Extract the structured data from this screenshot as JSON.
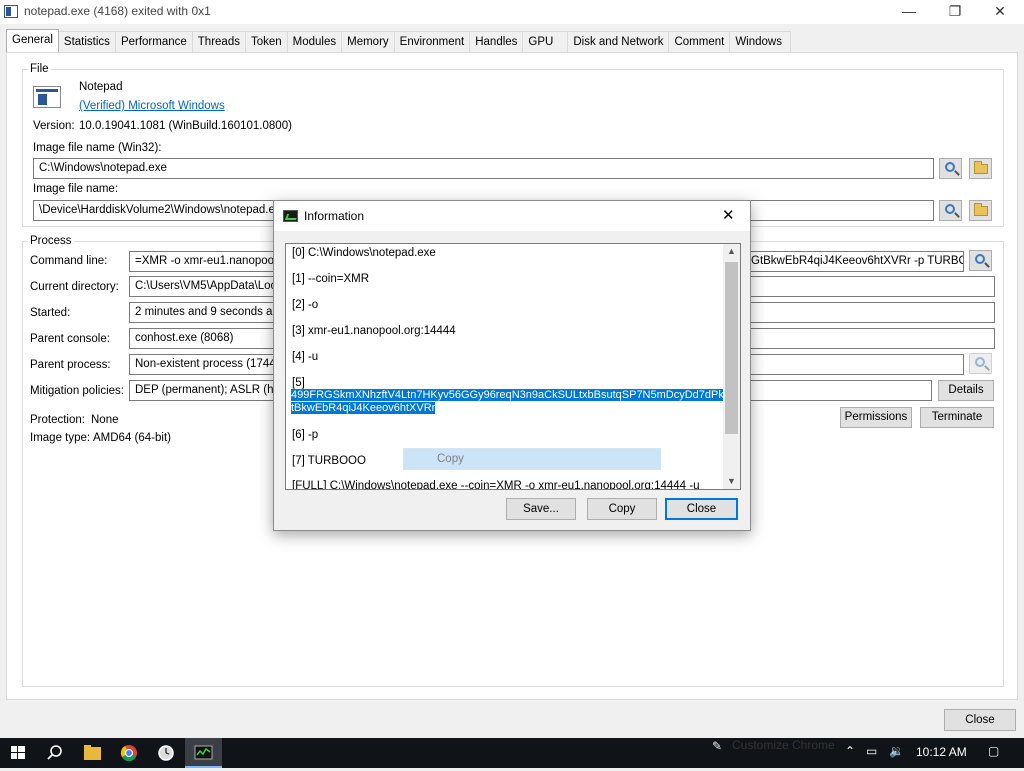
{
  "window": {
    "title": "notepad.exe (4168) exited with 0x1",
    "minimize": "—",
    "maximize": "❐",
    "close": "✕"
  },
  "tabs": [
    "General",
    "Statistics",
    "Performance",
    "Threads",
    "Token",
    "Modules",
    "Memory",
    "Environment",
    "Handles",
    "GPU",
    "Disk and Network",
    "Comment",
    "Windows"
  ],
  "file": {
    "group_label": "File",
    "name": "Notepad",
    "verified": "(Verified) Microsoft Windows",
    "version_label": "Version:",
    "version_value": "10.0.19041.1081 (WinBuild.160101.0800)",
    "image_win32_label": "Image file name (Win32):",
    "image_win32_value": "C:\\Windows\\notepad.exe",
    "image_label": "Image file name:",
    "image_value": "\\Device\\HarddiskVolume2\\Windows\\notepad.exe"
  },
  "process": {
    "group_label": "Process",
    "cmdline_label": "Command line:",
    "cmdline_left": "=XMR -o xmr-eu1.nanopool.o",
    "cmdline_right": "GtBkwEbR4qiJ4Keeov6htXVRr -p TURBOOO",
    "curdir_label": "Current directory:",
    "curdir_value": "C:\\Users\\VM5\\AppData\\Loca",
    "started_label": "Started:",
    "started_value": "2 minutes and 9 seconds ago",
    "parent_console_label": "Parent console:",
    "parent_console_value": "conhost.exe (8068)",
    "parent_process_label": "Parent process:",
    "parent_process_value": "Non-existent process (1744)",
    "mitigation_label": "Mitigation policies:",
    "mitigation_value": "DEP (permanent); ASLR (high",
    "details_button": "Details",
    "protection_label": "Protection:",
    "protection_value": "None",
    "image_type_label": "Image type:",
    "image_type_value": "AMD64 (64-bit)",
    "permissions_button": "Permissions",
    "terminate_button": "Terminate"
  },
  "close_button": "Close",
  "dialog": {
    "title": "Information",
    "close_glyph": "✕",
    "items": [
      "[0] C:\\Windows\\notepad.exe",
      "[1] --coin=XMR",
      "[2] -o",
      "[3] xmr-eu1.nanopool.org:14444",
      "[4] -u",
      "[5]",
      "[6] -p",
      "[7] TURBOOO",
      "[FULL] C:\\Windows\\notepad.exe --coin=XMR -o xmr-eu1.nanopool.org:14444 -u"
    ],
    "selected_line1": "499FRGSkmXNhzftV4Ltn7HKyv56GGy96reqN3n9aCkSULtxbBsutqSP7N5mDcyDd7dPknuG",
    "selected_line2": "tBkwEbR4qiJ4Keeov6htXVRr",
    "context_menu": "Copy",
    "save_button": "Save...",
    "copy_button": "Copy",
    "close_button": "Close"
  },
  "taskbar": {
    "time": "10:12 AM",
    "customize": "Customize Chrome"
  }
}
